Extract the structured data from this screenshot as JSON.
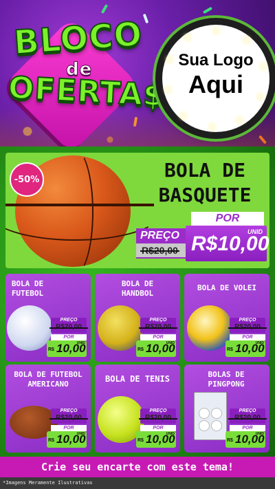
{
  "header": {
    "title_line1": "BLOCO",
    "title_line2": "de",
    "title_line3": "OFERTA$",
    "logo_placeholder_line1": "Sua Logo",
    "logo_placeholder_line2": "Aqui"
  },
  "hero": {
    "discount_badge": "-50%",
    "title_line1": "BOLA DE",
    "title_line2": "BASQUETE",
    "price_label": "PREÇO",
    "old_price": "R$20,00",
    "por_label": "POR",
    "unit_label": "UNID",
    "new_price": "R$10,00"
  },
  "products": [
    {
      "name": "BOLA DE FUTEBOL",
      "price_label": "PREÇO",
      "old_price": "R$20,00",
      "por_label": "POR",
      "unit_label": "UNID",
      "currency": "R$",
      "new_price": "10,00"
    },
    {
      "name": "BOLA DE HANDBOL",
      "price_label": "PREÇO",
      "old_price": "R$20,00",
      "por_label": "POR",
      "unit_label": "UNID",
      "currency": "R$",
      "new_price": "10,00"
    },
    {
      "name": "BOLA DE VOLEI",
      "price_label": "PREÇO",
      "old_price": "R$20,00",
      "por_label": "POR",
      "unit_label": "UNID",
      "currency": "R$",
      "new_price": "10,00"
    },
    {
      "name": "BOLA DE FUTEBOL AMERICANO",
      "price_label": "PREÇO",
      "old_price": "R$20,00",
      "por_label": "POR",
      "unit_label": "UNID",
      "currency": "R$",
      "new_price": "10,00"
    },
    {
      "name": "BOLA DE TENIS",
      "price_label": "PREÇO",
      "old_price": "R$20,00",
      "por_label": "POR",
      "unit_label": "UNID",
      "currency": "R$",
      "new_price": "10,00"
    },
    {
      "name": "BOLAS DE PINGPONG",
      "price_label": "PREÇO",
      "old_price": "R$20,00",
      "por_label": "POR",
      "unit_label": "UNID",
      "currency": "R$",
      "new_price": "10,00"
    }
  ],
  "cta": "Crie seu encarte com este tema!",
  "disclaimer": "*Imagens Meramente Ilustrativas",
  "colors": {
    "purple": "#9b2cc9",
    "green": "#7ade3a",
    "magenta": "#c71ab4"
  }
}
